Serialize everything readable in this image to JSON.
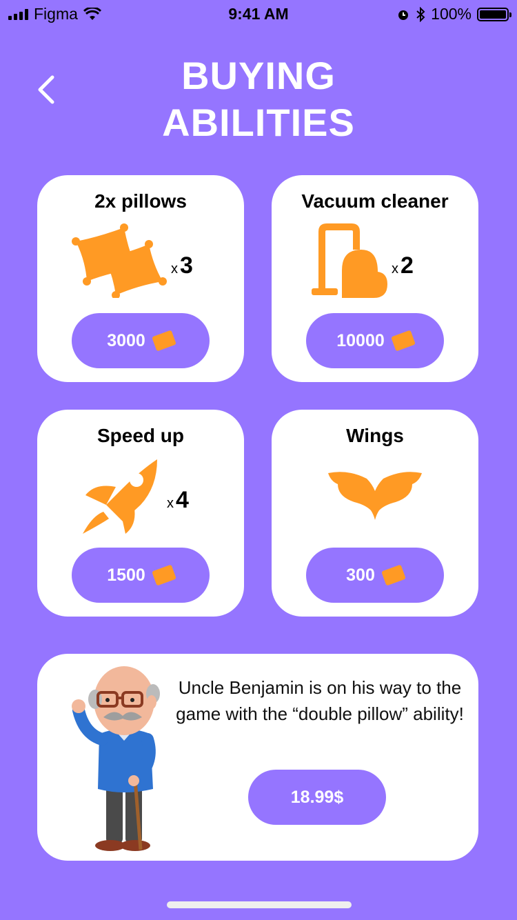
{
  "status_bar": {
    "carrier": "Figma",
    "time": "9:41 AM",
    "battery_percent": "100%"
  },
  "header": {
    "title_line1": "BUYING",
    "title_line2": "ABILITIES",
    "back_icon": "chevron-left-icon"
  },
  "abilities": [
    {
      "title": "2x pillows",
      "qty_prefix": "x",
      "qty": "3",
      "price": "3000",
      "icon": "pillows-icon"
    },
    {
      "title": "Vacuum cleaner",
      "qty_prefix": "x",
      "qty": "2",
      "price": "10000",
      "icon": "vacuum-icon"
    },
    {
      "title": "Speed up",
      "qty_prefix": "x",
      "qty": "4",
      "price": "1500",
      "icon": "rocket-icon"
    },
    {
      "title": "Wings",
      "qty_prefix": "",
      "qty": "",
      "price": "300",
      "icon": "wings-icon"
    }
  ],
  "promo": {
    "text": "Uncle Benjamin is on his way to the game with the “double pillow” ability!",
    "price": "18.99$",
    "character": "uncle-benjamin-illustration"
  },
  "colors": {
    "background": "#9575FF",
    "accent": "#FF9A24",
    "card": "#FFFFFF"
  }
}
